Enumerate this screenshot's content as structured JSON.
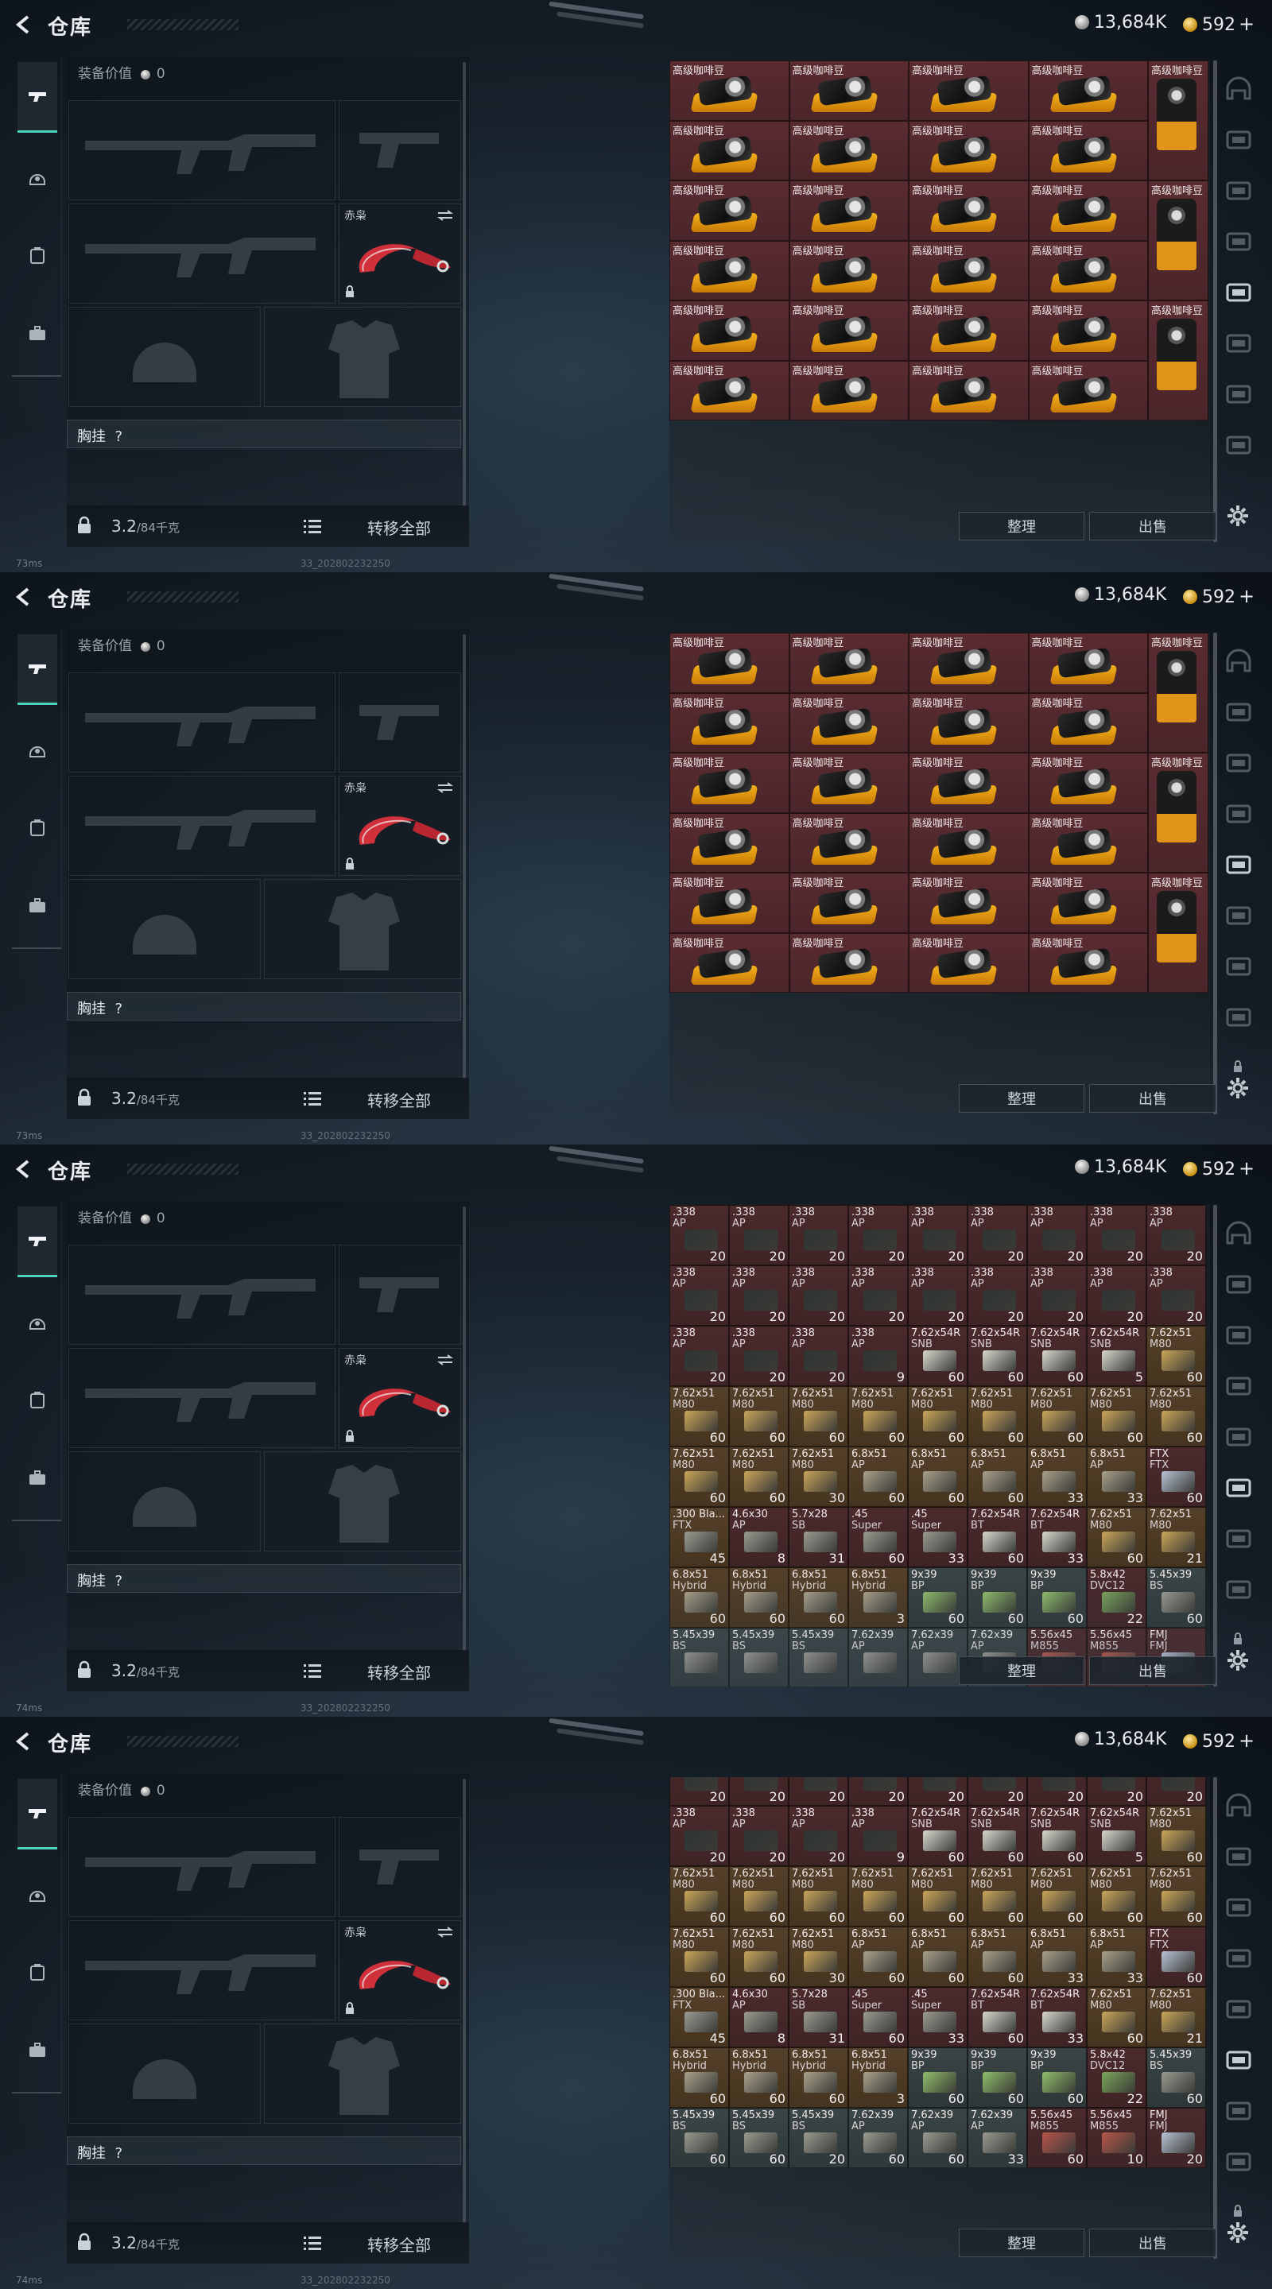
{
  "header": {
    "title": "仓库",
    "silver_amount": "13,684K",
    "gold_amount": "592",
    "gold_plus": "+"
  },
  "equipment": {
    "value_label": "装备价值",
    "value_amount": "0",
    "knife_name": "赤枭",
    "vest_label": "胸挂",
    "vest_hint": "?",
    "weight_current": "3.2",
    "weight_max": "/84千克",
    "transfer_all": "转移全部"
  },
  "storage": {
    "sort_label": "整理",
    "sell_label": "出售",
    "coffee_name": "高级咖啡豆",
    "panel3_ammo_rows": [
      [
        [
          ".338",
          "AP",
          "20"
        ],
        [
          ".338",
          "AP",
          "20"
        ],
        [
          ".338",
          "AP",
          "20"
        ],
        [
          ".338",
          "AP",
          "20"
        ],
        [
          ".338",
          "AP",
          "20"
        ],
        [
          ".338",
          "AP",
          "20"
        ],
        [
          ".338",
          "AP",
          "20"
        ],
        [
          ".338",
          "AP",
          "20"
        ],
        [
          ".338",
          "AP",
          "20"
        ]
      ],
      [
        [
          ".338",
          "AP",
          "20"
        ],
        [
          ".338",
          "AP",
          "20"
        ],
        [
          ".338",
          "AP",
          "20"
        ],
        [
          ".338",
          "AP",
          "20"
        ],
        [
          ".338",
          "AP",
          "20"
        ],
        [
          ".338",
          "AP",
          "20"
        ],
        [
          ".338",
          "AP",
          "20"
        ],
        [
          ".338",
          "AP",
          "20"
        ],
        [
          ".338",
          "AP",
          "20"
        ]
      ],
      [
        [
          ".338",
          "AP",
          "20"
        ],
        [
          ".338",
          "AP",
          "20"
        ],
        [
          ".338",
          "AP",
          "20"
        ],
        [
          ".338",
          "AP",
          "9"
        ],
        [
          "7.62x54R",
          "SNB",
          "60"
        ],
        [
          "7.62x54R",
          "SNB",
          "60"
        ],
        [
          "7.62x54R",
          "SNB",
          "60"
        ],
        [
          "7.62x54R",
          "SNB",
          "5"
        ],
        [
          "7.62x51",
          "M80",
          "60"
        ]
      ],
      [
        [
          "7.62x51",
          "M80",
          "60"
        ],
        [
          "7.62x51",
          "M80",
          "60"
        ],
        [
          "7.62x51",
          "M80",
          "60"
        ],
        [
          "7.62x51",
          "M80",
          "60"
        ],
        [
          "7.62x51",
          "M80",
          "60"
        ],
        [
          "7.62x51",
          "M80",
          "60"
        ],
        [
          "7.62x51",
          "M80",
          "60"
        ],
        [
          "7.62x51",
          "M80",
          "60"
        ],
        [
          "7.62x51",
          "M80",
          "60"
        ]
      ],
      [
        [
          "7.62x51",
          "M80",
          "60"
        ],
        [
          "7.62x51",
          "M80",
          "60"
        ],
        [
          "7.62x51",
          "M80",
          "30"
        ],
        [
          "6.8x51",
          "AP",
          "60"
        ],
        [
          "6.8x51",
          "AP",
          "60"
        ],
        [
          "6.8x51",
          "AP",
          "60"
        ],
        [
          "6.8x51",
          "AP",
          "33"
        ],
        [
          "6.8x51",
          "AP",
          "33"
        ],
        [
          "FTX",
          "FTX",
          "60"
        ]
      ],
      [
        [
          ".300 Bla...",
          "FTX",
          "45"
        ],
        [
          "4.6x30",
          "AP",
          "8"
        ],
        [
          "5.7x28",
          "SB",
          "31"
        ],
        [
          ".45",
          "Super",
          "60"
        ],
        [
          ".45",
          "Super",
          "33"
        ],
        [
          "7.62x54R",
          "BT",
          "60"
        ],
        [
          "7.62x54R",
          "BT",
          "33"
        ],
        [
          "7.62x51",
          "M80",
          "60"
        ],
        [
          "7.62x51",
          "M80",
          "21"
        ]
      ],
      [
        [
          "6.8x51",
          "Hybrid",
          "60"
        ],
        [
          "6.8x51",
          "Hybrid",
          "60"
        ],
        [
          "6.8x51",
          "Hybrid",
          "60"
        ],
        [
          "6.8x51",
          "Hybrid",
          "3"
        ],
        [
          "9x39",
          "BP",
          "60"
        ],
        [
          "9x39",
          "BP",
          "60"
        ],
        [
          "9x39",
          "BP",
          "60"
        ],
        [
          "5.8x42",
          "DVC12",
          "22"
        ],
        [
          "5.45x39",
          "BS",
          "60"
        ]
      ],
      [
        [
          "5.45x39",
          "BS",
          ""
        ],
        [
          "5.45x39",
          "BS",
          ""
        ],
        [
          "5.45x39",
          "BS",
          ""
        ],
        [
          "7.62x39",
          "AP",
          ""
        ],
        [
          "7.62x39",
          "AP",
          ""
        ],
        [
          "7.62x39",
          "AP",
          ""
        ],
        [
          "5.56x45",
          "M855",
          ""
        ],
        [
          "5.56x45",
          "M855",
          ""
        ],
        [
          "FMJ",
          "FMJ",
          ""
        ]
      ]
    ],
    "panel4_ammo_rows": [
      [
        [
          "",
          "AP",
          "20"
        ],
        [
          "",
          "AP",
          "20"
        ],
        [
          "",
          "AP",
          "20"
        ],
        [
          "",
          "AP",
          "20"
        ],
        [
          "",
          "AP",
          "20"
        ],
        [
          "",
          "AP",
          "20"
        ],
        [
          "",
          "AP",
          "20"
        ],
        [
          "",
          "AP",
          "20"
        ],
        [
          "",
          "AP",
          "20"
        ]
      ],
      [
        [
          ".338",
          "AP",
          "20"
        ],
        [
          ".338",
          "AP",
          "20"
        ],
        [
          ".338",
          "AP",
          "20"
        ],
        [
          ".338",
          "AP",
          "9"
        ],
        [
          "7.62x54R",
          "SNB",
          "60"
        ],
        [
          "7.62x54R",
          "SNB",
          "60"
        ],
        [
          "7.62x54R",
          "SNB",
          "60"
        ],
        [
          "7.62x54R",
          "SNB",
          "5"
        ],
        [
          "7.62x51",
          "M80",
          "60"
        ]
      ],
      [
        [
          "7.62x51",
          "M80",
          "60"
        ],
        [
          "7.62x51",
          "M80",
          "60"
        ],
        [
          "7.62x51",
          "M80",
          "60"
        ],
        [
          "7.62x51",
          "M80",
          "60"
        ],
        [
          "7.62x51",
          "M80",
          "60"
        ],
        [
          "7.62x51",
          "M80",
          "60"
        ],
        [
          "7.62x51",
          "M80",
          "60"
        ],
        [
          "7.62x51",
          "M80",
          "60"
        ],
        [
          "7.62x51",
          "M80",
          "60"
        ]
      ],
      [
        [
          "7.62x51",
          "M80",
          "60"
        ],
        [
          "7.62x51",
          "M80",
          "60"
        ],
        [
          "7.62x51",
          "M80",
          "30"
        ],
        [
          "6.8x51",
          "AP",
          "60"
        ],
        [
          "6.8x51",
          "AP",
          "60"
        ],
        [
          "6.8x51",
          "AP",
          "60"
        ],
        [
          "6.8x51",
          "AP",
          "33"
        ],
        [
          "6.8x51",
          "AP",
          "33"
        ],
        [
          "FTX",
          "FTX",
          "60"
        ]
      ],
      [
        [
          ".300 Bla...",
          "FTX",
          "45"
        ],
        [
          "4.6x30",
          "AP",
          "8"
        ],
        [
          "5.7x28",
          "SB",
          "31"
        ],
        [
          ".45",
          "Super",
          "60"
        ],
        [
          ".45",
          "Super",
          "33"
        ],
        [
          "7.62x54R",
          "BT",
          "60"
        ],
        [
          "7.62x54R",
          "BT",
          "33"
        ],
        [
          "7.62x51",
          "M80",
          "60"
        ],
        [
          "7.62x51",
          "M80",
          "21"
        ]
      ],
      [
        [
          "6.8x51",
          "Hybrid",
          "60"
        ],
        [
          "6.8x51",
          "Hybrid",
          "60"
        ],
        [
          "6.8x51",
          "Hybrid",
          "60"
        ],
        [
          "6.8x51",
          "Hybrid",
          "3"
        ],
        [
          "9x39",
          "BP",
          "60"
        ],
        [
          "9x39",
          "BP",
          "60"
        ],
        [
          "9x39",
          "BP",
          "60"
        ],
        [
          "5.8x42",
          "DVC12",
          "22"
        ],
        [
          "5.45x39",
          "BS",
          "60"
        ]
      ],
      [
        [
          "5.45x39",
          "BS",
          "60"
        ],
        [
          "5.45x39",
          "BS",
          "60"
        ],
        [
          "5.45x39",
          "BS",
          "20"
        ],
        [
          "7.62x39",
          "AP",
          "60"
        ],
        [
          "7.62x39",
          "AP",
          "60"
        ],
        [
          "7.62x39",
          "AP",
          "33"
        ],
        [
          "5.56x45",
          "M855",
          "60"
        ],
        [
          "5.56x45",
          "M855",
          "10"
        ],
        [
          "FMJ",
          "FMJ",
          "20"
        ]
      ]
    ]
  },
  "status": {
    "ping_values": [
      "73ms",
      "73ms",
      "74ms",
      "74ms"
    ],
    "build": "33_202802232250"
  }
}
